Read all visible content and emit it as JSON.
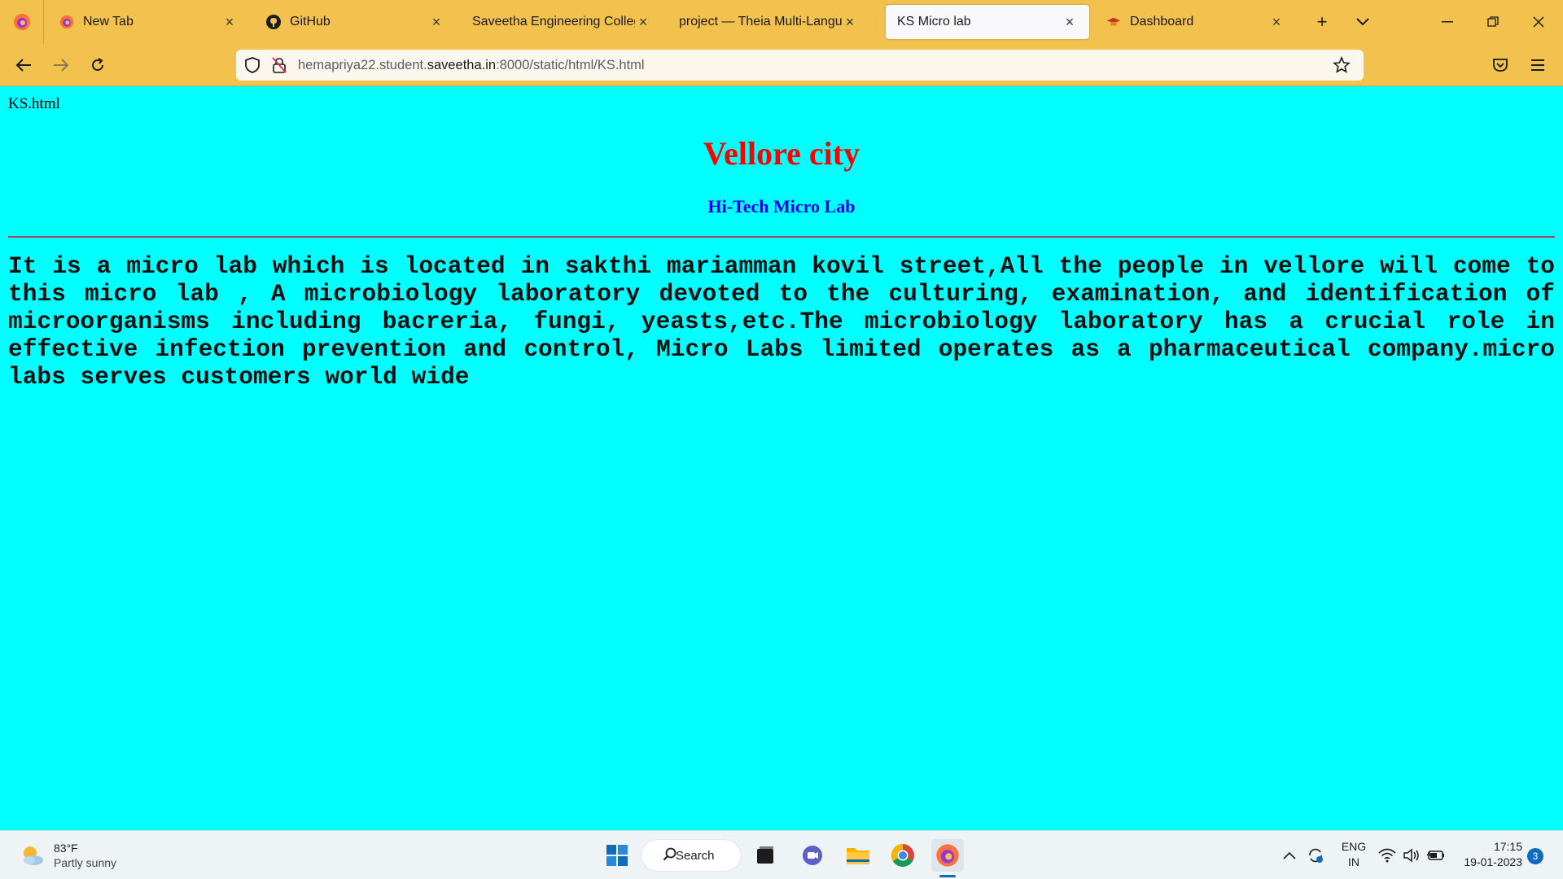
{
  "browser": {
    "tabs": [
      {
        "label": "New Tab",
        "icon": "firefox-icon"
      },
      {
        "label": "GitHub",
        "icon": "github-icon"
      },
      {
        "label": "Saveetha Engineering College",
        "icon": "none"
      },
      {
        "label": "project — Theia Multi-Language",
        "icon": "none"
      },
      {
        "label": "KS Micro lab",
        "icon": "none",
        "active": true
      },
      {
        "label": "Dashboard",
        "icon": "graduation-cap-icon"
      }
    ],
    "url": {
      "prefix": "hemapriya22.student.",
      "domain": "saveetha.in",
      "suffix": ":8000/static/html/KS.html"
    }
  },
  "page": {
    "file_label": "KS.html",
    "title": "Vellore city",
    "subtitle": "Hi-Tech Micro Lab",
    "paragraph": "It is a micro lab which is located in sakthi mariamman kovil street,All the people in vellore will come to this micro lab , A microbiology laboratory devoted to the culturing, examination, and identification of microorganisms including bacreria, fungi, yeasts,etc.The microbiology laboratory has a crucial role in effective infection prevention and control, Micro Labs limited operates as a pharmaceutical company.micro labs serves customers world wide",
    "colors": {
      "background": "#00ffff",
      "title": "#ff0000",
      "subtitle": "#0000ff"
    }
  },
  "taskbar": {
    "weather": {
      "temp": "83°F",
      "condition": "Partly sunny"
    },
    "search_label": "Search",
    "lang": {
      "line1": "ENG",
      "line2": "IN"
    },
    "clock": {
      "time": "17:15",
      "date": "19-01-2023"
    },
    "notification_count": "3"
  }
}
